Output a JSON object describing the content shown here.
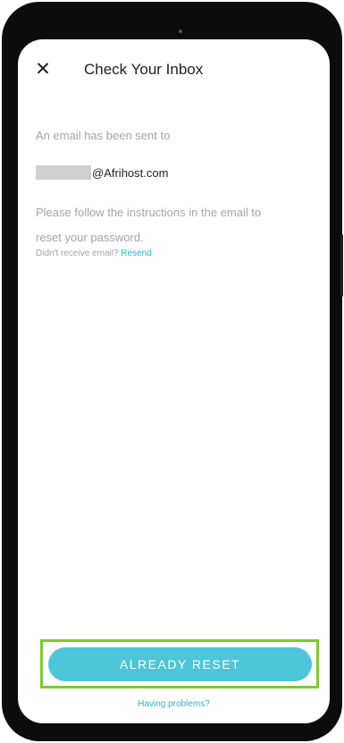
{
  "header": {
    "close_icon": "✕",
    "title": "Check Your Inbox"
  },
  "content": {
    "sent_label": "An email has been sent to",
    "email_domain": "@Afrihost.com",
    "instructions_line1": "Please follow the instructions in the email to",
    "instructions_line2": "reset your password.",
    "not_received_prefix": "Didn't receive email?",
    "resend_label": "Resend"
  },
  "footer": {
    "primary_button_label": "ALREADY RESET",
    "help_link": "Having problems?"
  },
  "colors": {
    "accent": "#4ec6d9",
    "link": "#2db4c8",
    "highlight_frame": "#7dcc2f",
    "muted_text": "#a5a5a5"
  }
}
